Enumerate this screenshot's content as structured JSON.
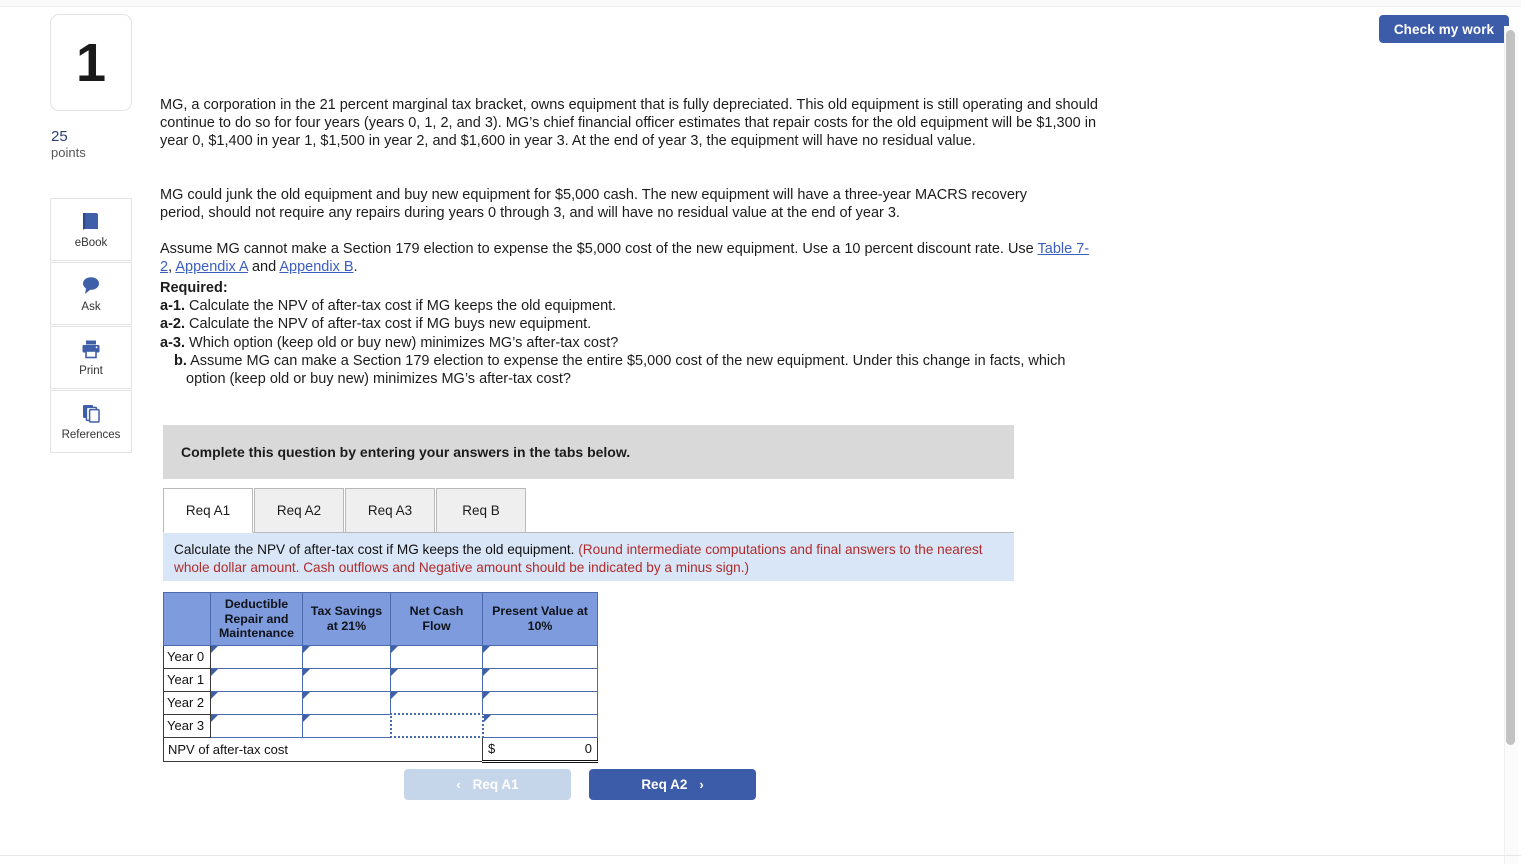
{
  "header": {
    "check_my_work_label": "Check my work"
  },
  "rail": {
    "question_number": "1",
    "points_value": "25",
    "points_label": "points",
    "tools": [
      {
        "icon": "ebook-icon",
        "label": "eBook"
      },
      {
        "icon": "ask-chat-icon",
        "label": "Ask"
      },
      {
        "icon": "printer-icon",
        "label": "Print"
      },
      {
        "icon": "references-pages-icon",
        "label": "References"
      }
    ]
  },
  "question": {
    "paragraph_1": "MG, a corporation in the 21 percent marginal tax bracket, owns equipment that is fully depreciated. This old equipment is still operating and should continue to do so for four years (years 0, 1, 2, and 3). MG’s chief financial officer estimates that repair costs for the old equipment will be $1,300 in year 0, $1,400 in year 1, $1,500 in year 2, and $1,600 in year 3. At the end of year 3, the equipment will have no residual value.",
    "paragraph_2": "MG could junk the old equipment and buy new equipment for $5,000 cash. The new equipment will have a three-year MACRS recovery period, should not require any repairs during years 0 through 3, and will have no residual value at the end of year 3.",
    "paragraph_3_pre": "Assume MG cannot make a Section 179 election to expense the $5,000 cost of the new equipment. Use a 10 percent discount rate. Use ",
    "link_table": "Table 7-2",
    "paragraph_3_sep1": ", ",
    "link_appendix_a": "Appendix A",
    "paragraph_3_sep2": " and ",
    "link_appendix_b": "Appendix B",
    "paragraph_3_end": ".",
    "required_heading": "Required:",
    "req_a1_marker": "a-1.",
    "req_a1_text": " Calculate the NPV of after-tax cost if MG keeps the old equipment.",
    "req_a2_marker": "a-2.",
    "req_a2_text": " Calculate the NPV of after-tax cost if MG buys new equipment.",
    "req_a3_marker": "a-3.",
    "req_a3_text": " Which option (keep old or buy new) minimizes MG’s after-tax cost?",
    "req_b_marker": "b.",
    "req_b_text": " Assume MG can make a Section 179 election to expense the entire $5,000 cost of the new equipment. Under this change in facts, which option (keep old or buy new) minimizes MG’s after-tax cost?"
  },
  "banner": {
    "gray_text": "Complete this question by entering your answers in the tabs below."
  },
  "tabs": [
    {
      "label": "Req A1",
      "active": true
    },
    {
      "label": "Req A2",
      "active": false
    },
    {
      "label": "Req A3",
      "active": false
    },
    {
      "label": "Req B",
      "active": false
    }
  ],
  "instruction": {
    "main": "Calculate the NPV of after-tax cost if MG keeps the old equipment. ",
    "note": "(Round intermediate computations and final answers to the nearest whole dollar amount. Cash outflows and Negative amount should be indicated by a minus sign.)"
  },
  "answer_table": {
    "headers": [
      "",
      "Deductible Repair and Maintenance",
      "Tax Savings at 21%",
      "Net Cash Flow",
      "Present Value at 10%"
    ],
    "rows": [
      {
        "label": "Year 0",
        "values": [
          "",
          "",
          "",
          ""
        ]
      },
      {
        "label": "Year 1",
        "values": [
          "",
          "",
          "",
          ""
        ]
      },
      {
        "label": "Year 2",
        "values": [
          "",
          "",
          "",
          ""
        ]
      },
      {
        "label": "Year 3",
        "values": [
          "",
          "",
          "",
          ""
        ]
      }
    ],
    "focused_cell": {
      "row": 3,
      "col": 2
    },
    "total_label": "NPV of after-tax cost",
    "total_currency": "$",
    "total_value": "0"
  },
  "nav": {
    "prev_label": "Req A1",
    "prev_chevron": "‹",
    "next_label": "Req A2",
    "next_chevron": "›",
    "prev_disabled": true
  },
  "colors": {
    "primary_blue": "#3c5ba9",
    "table_header_blue": "#7d9bdd",
    "instruction_bg": "#d9e6f7",
    "note_red": "#b02b2b",
    "gray_banner": "#d9d9d9",
    "disabled_blue": "#c5d5ea"
  }
}
